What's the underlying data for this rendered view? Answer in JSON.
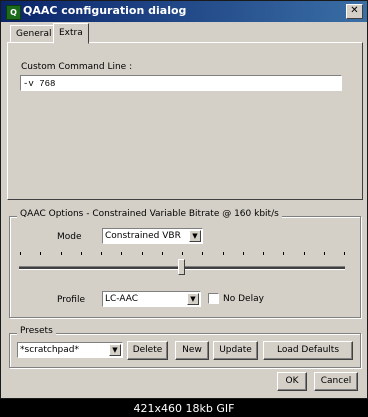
{
  "window": {
    "title": "QAAC configuration dialog",
    "app_icon_glyph": "Q",
    "close_glyph": "✕"
  },
  "tabs": [
    {
      "label": "General"
    },
    {
      "label": "Extra"
    }
  ],
  "extra": {
    "command_label": "Custom Command Line :",
    "command_value": "-v 768"
  },
  "options": {
    "group_label": "QAAC Options - Constrained Variable Bitrate @ 160 kbit/s",
    "mode_label": "Mode",
    "mode_value": "Constrained VBR",
    "bitrate_kbps": 160,
    "profile_label": "Profile",
    "profile_value": "LC-AAC",
    "no_delay_label": "No Delay",
    "no_delay_checked": false
  },
  "presets": {
    "group_label": "Presets",
    "selected": "*scratchpad*",
    "delete_label": "Delete",
    "new_label": "New",
    "update_label": "Update",
    "load_defaults_label": "Load Defaults"
  },
  "buttons": {
    "ok_label": "OK",
    "cancel_label": "Cancel"
  },
  "status": {
    "text": "421x460 18kb GIF"
  },
  "icons": {
    "dropdown_arrow": "chevron-down-icon",
    "app": "qaac-app-icon",
    "close": "close-icon"
  }
}
